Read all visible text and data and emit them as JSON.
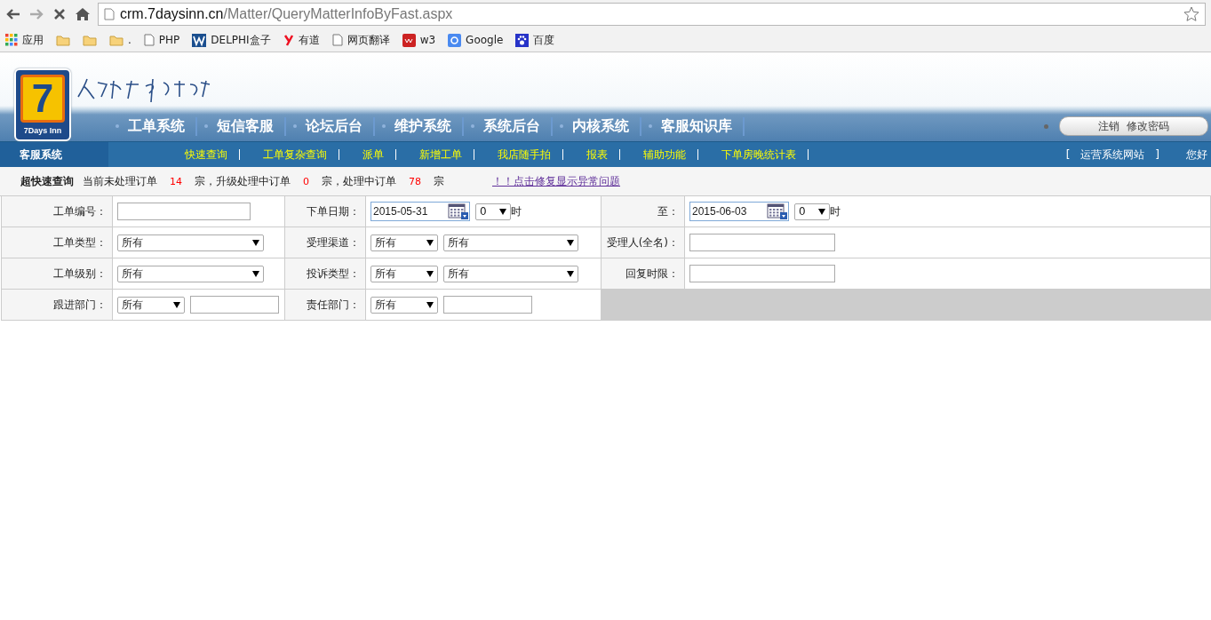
{
  "browser": {
    "url": {
      "host": "crm.7daysinn.cn",
      "path": "/Matter/QueryMatterInfoByFast.aspx"
    },
    "bookmarks": [
      {
        "kind": "apps",
        "label": "应用"
      },
      {
        "kind": "folder"
      },
      {
        "kind": "folder"
      },
      {
        "kind": "folder",
        "label": "."
      },
      {
        "kind": "page",
        "label": "PHP"
      },
      {
        "kind": "delphi",
        "label": "DELPHI盒子"
      },
      {
        "kind": "youdao",
        "label": "有道"
      },
      {
        "kind": "page",
        "label": "网页翻译"
      },
      {
        "kind": "w3",
        "label": "w3"
      },
      {
        "kind": "google",
        "label": "Google"
      },
      {
        "kind": "baidu",
        "label": "百度"
      }
    ]
  },
  "logo": {
    "numeral": "7",
    "name": "7Days Inn"
  },
  "main_nav": [
    "工单系统",
    "短信客服",
    "论坛后台",
    "维护系统",
    "系统后台",
    "内核系统",
    "客服知识库"
  ],
  "account_links": [
    "注销",
    "修改密码"
  ],
  "sub_nav": {
    "section": "客服系统",
    "links": [
      "快速查询",
      "工单复杂查询",
      "派单",
      "新增工单",
      "我店随手拍",
      "报表",
      "辅助功能",
      "下单房晚统计表"
    ],
    "site_link": {
      "open": "[",
      "label": "运营系统网站",
      "close": "]"
    },
    "greeting": "您好"
  },
  "summary": {
    "title": "超快速查询",
    "parts": [
      {
        "kind": "text",
        "text": "当前未处理订单"
      },
      {
        "kind": "count",
        "text": "14"
      },
      {
        "kind": "text",
        "text": "宗，升级处理中订单"
      },
      {
        "kind": "count",
        "text": "0"
      },
      {
        "kind": "text",
        "text": "宗，处理中订单"
      },
      {
        "kind": "count",
        "text": "78"
      },
      {
        "kind": "text",
        "text": "宗"
      }
    ],
    "fix_link": "！！点击修复显示异常问题"
  },
  "form_rows": [
    {
      "cells": [
        {
          "label": "工单编号：",
          "fields": [
            {
              "kind": "text"
            }
          ]
        },
        {
          "label": "下单日期：",
          "fields": [
            {
              "kind": "date",
              "value": "2015-05-31",
              "hour": "0",
              "unit": "时"
            }
          ]
        },
        {
          "label": "至：",
          "fields": [
            {
              "kind": "date",
              "value": "2015-06-03",
              "hour": "0",
              "unit": "时"
            }
          ]
        }
      ]
    },
    {
      "cells": [
        {
          "label": "工单类型：",
          "fields": [
            {
              "kind": "select",
              "value": "所有"
            }
          ]
        },
        {
          "label": "受理渠道：",
          "fields": [
            {
              "kind": "select",
              "value": "所有"
            },
            {
              "kind": "select",
              "value": "所有"
            }
          ]
        },
        {
          "label": "受理人(全名)：",
          "fields": [
            {
              "kind": "text"
            }
          ]
        }
      ]
    },
    {
      "cells": [
        {
          "label": "工单级别：",
          "fields": [
            {
              "kind": "select",
              "value": "所有"
            }
          ]
        },
        {
          "label": "投诉类型：",
          "fields": [
            {
              "kind": "select",
              "value": "所有"
            },
            {
              "kind": "select",
              "value": "所有"
            }
          ]
        },
        {
          "label": "回复时限：",
          "fields": [
            {
              "kind": "text"
            }
          ]
        }
      ]
    },
    {
      "cells": [
        {
          "label": "跟进部门：",
          "fields": [
            {
              "kind": "select",
              "value": "所有"
            },
            {
              "kind": "text"
            }
          ]
        },
        {
          "label": "责任部门：",
          "fields": [
            {
              "kind": "select",
              "value": "所有"
            },
            {
              "kind": "text"
            }
          ]
        }
      ]
    }
  ]
}
